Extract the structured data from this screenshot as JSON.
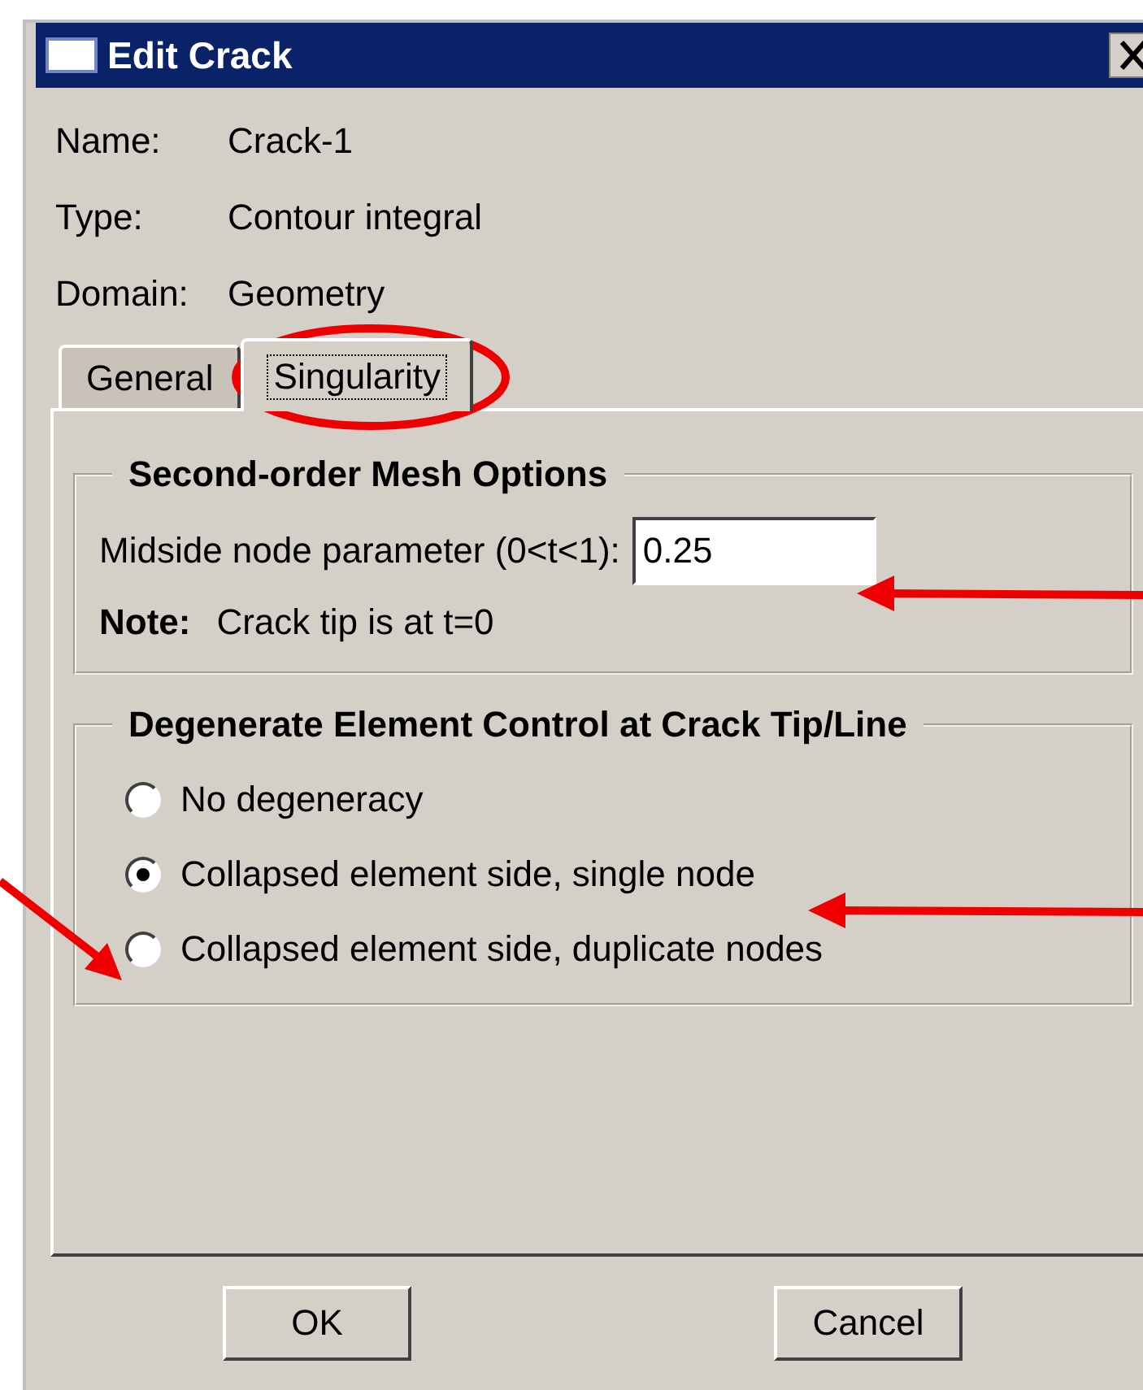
{
  "window": {
    "title": "Edit Crack"
  },
  "fields": [
    {
      "label": "Name:",
      "value": "Crack-1"
    },
    {
      "label": "Type:",
      "value": "Contour integral"
    },
    {
      "label": "Domain:",
      "value": "Geometry"
    }
  ],
  "tabs": [
    {
      "label": "General",
      "selected": false
    },
    {
      "label": "Singularity",
      "selected": true
    }
  ],
  "mesh_options": {
    "title": "Second-order Mesh Options",
    "parameter_label": "Midside node parameter (0<t<1):",
    "parameter_value": "0.25",
    "note_label": "Note:",
    "note_text": "Crack tip is at t=0"
  },
  "degenerate_control": {
    "title": "Degenerate Element Control at Crack Tip/Line",
    "options": [
      {
        "label": "No degeneracy",
        "selected": false
      },
      {
        "label": "Collapsed element side, single node",
        "selected": true
      },
      {
        "label": "Collapsed element side, duplicate nodes",
        "selected": false
      }
    ]
  },
  "buttons": [
    "OK",
    "Cancel"
  ]
}
